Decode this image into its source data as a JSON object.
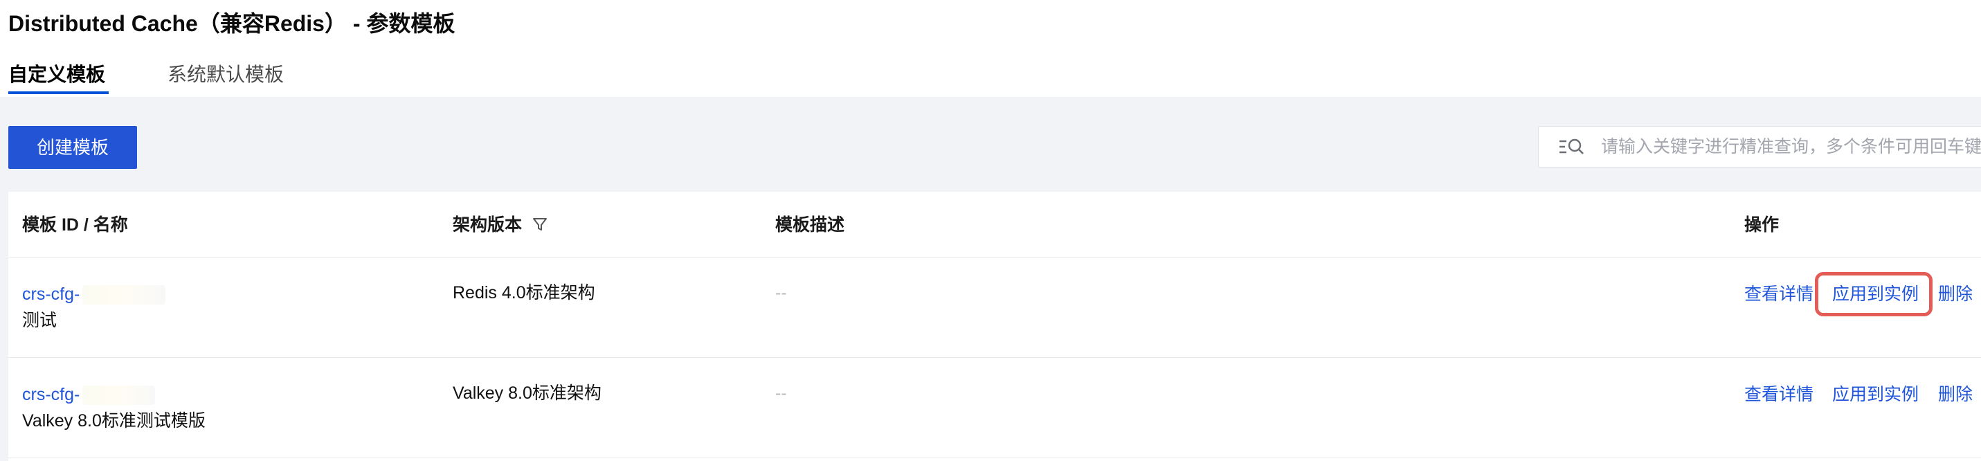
{
  "header": {
    "title": "Distributed Cache（兼容Redis） - 参数模板"
  },
  "tabs": [
    {
      "label": "自定义模板",
      "active": true
    },
    {
      "label": "系统默认模板",
      "active": false
    }
  ],
  "toolbar": {
    "create_label": "创建模板",
    "search_placeholder": "请输入关键字进行精准查询，多个条件可用回车键"
  },
  "table": {
    "columns": [
      "模板 ID / 名称",
      "架构版本",
      "模板描述",
      "操作"
    ],
    "rows": [
      {
        "id": "crs-cfg-",
        "name": "测试",
        "arch": "Redis 4.0标准架构",
        "desc": "--",
        "actions": [
          "查看详情",
          "应用到实例",
          "删除"
        ]
      },
      {
        "id": "crs-cfg-",
        "name": "Valkey 8.0标准测试模版",
        "arch": "Valkey 8.0标准架构",
        "desc": "--",
        "actions": [
          "查看详情",
          "应用到实例",
          "删除"
        ]
      }
    ]
  },
  "colors": {
    "accent": "#0052d9",
    "primary_button": "#2354d6",
    "link": "#1f55d8",
    "highlight": "#e35c55",
    "background": "#f2f3f7"
  },
  "icons": {
    "search": "search-list-icon",
    "filter": "filter-icon"
  }
}
